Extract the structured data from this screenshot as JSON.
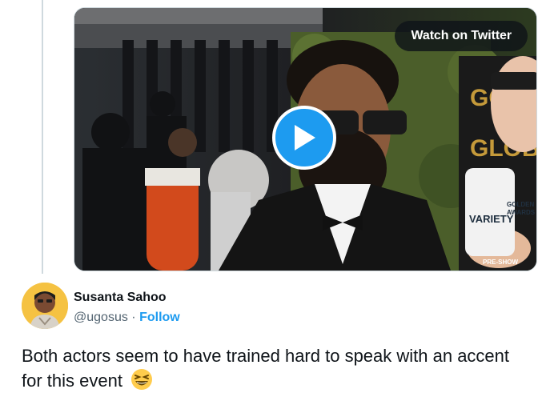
{
  "video": {
    "watch_label": "Watch on Twitter",
    "play_icon": "play-icon",
    "backdrop_text_lines": [
      "GOLD",
      "GLOB"
    ],
    "sign_text_lines": [
      "VARIETY",
      "GOLDEN",
      "AWARDS"
    ],
    "sign_footer": "PRE-SHOW",
    "colors": {
      "play_button": "#1d9bf0"
    }
  },
  "author": {
    "name": "Susanta Sahoo",
    "handle": "@ugosus",
    "separator": "·",
    "follow_label": "Follow",
    "avatar_icon": "user-avatar",
    "colors": {
      "follow": "#1d9bf0",
      "avatar_bg": "#f5c242"
    }
  },
  "tweet": {
    "text": "Both actors seem to have trained hard to speak with an accent for this event",
    "emoji_icon": "grinning-squinting-face-icon"
  }
}
